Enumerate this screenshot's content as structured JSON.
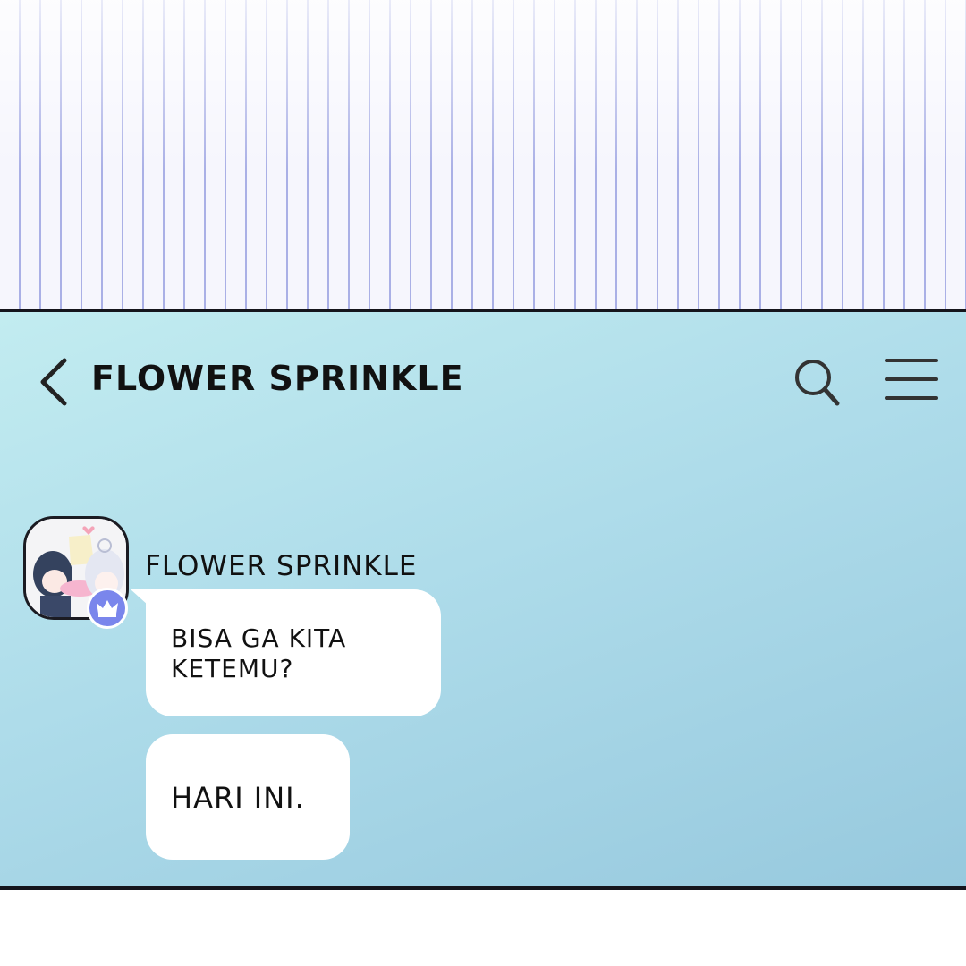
{
  "header": {
    "title": "FLOWER SPRINKLE"
  },
  "icons": {
    "back": "chevron-left-icon",
    "search": "search-icon",
    "menu": "menu-icon",
    "badge": "crown-icon"
  },
  "message_group": {
    "sender_name": "FLOWER SPRINKLE",
    "messages": [
      {
        "text": "BISA GA KITA KETEMU?"
      },
      {
        "text": "HARI INI."
      }
    ]
  },
  "colors": {
    "chat_background": "#aedcea",
    "bubble": "#ffffff",
    "badge": "#7a86ec",
    "stripe_line": "#aab0e6"
  }
}
